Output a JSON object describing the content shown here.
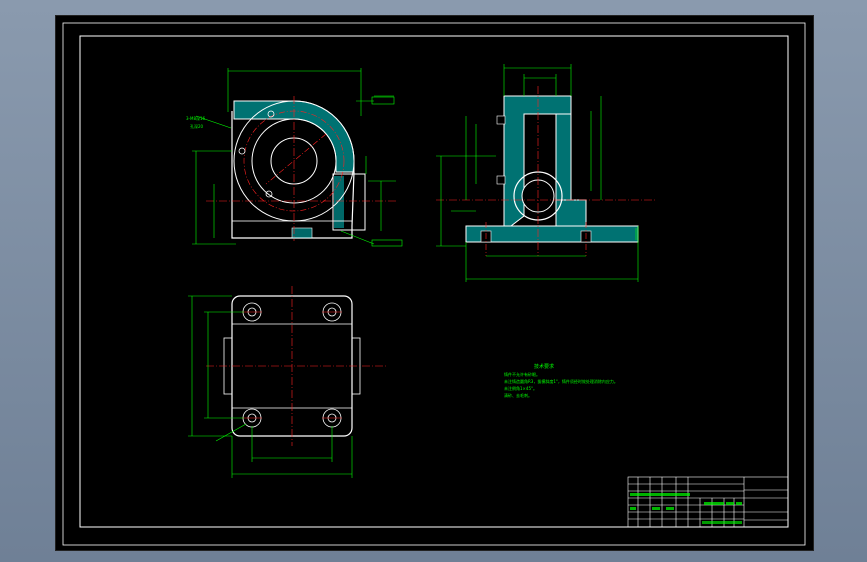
{
  "colors": {
    "background": "#000000",
    "frame": "#ffffff",
    "outline": "#ffffff",
    "centerline": "#ff2020",
    "dimension": "#00ff00",
    "hatch": "#00ffff"
  },
  "tech_requirements": {
    "title": "技术要求",
    "lines": [
      "铸件不允许有砂眼。",
      "未注铸造圆角R3，拔模斜度1°，铸件须经时效处理消除内应力。",
      "未注倒角1×45°。",
      "清砂、去毛刺。"
    ]
  },
  "annotations": {
    "front_hole_note": "3-M8深16",
    "front_hole_note2": "孔深20"
  },
  "title_block": {
    "cells": [
      "",
      "",
      "",
      "",
      "",
      "",
      ""
    ]
  }
}
